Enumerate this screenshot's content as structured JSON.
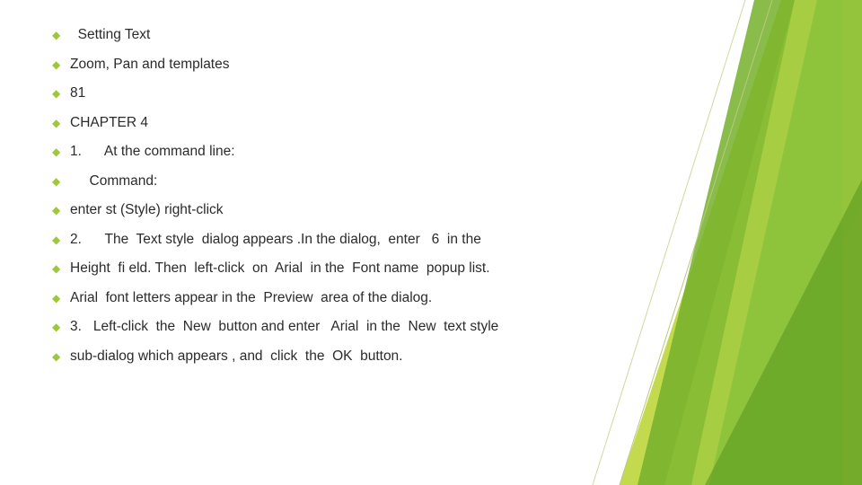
{
  "slide": {
    "bullet_glyph": "◆",
    "bullet_color": "#9ec73c",
    "background_color": "#ffffff",
    "text_color": "#2b2b2b",
    "accent_colors": {
      "light_green": "#c3d94e",
      "mid_green": "#8cc63e",
      "dark_green": "#6aa92a",
      "pale_green": "#dfe9a8",
      "deep_green": "#5f9c22"
    },
    "bullets": [
      {
        "text": "  Setting Text"
      },
      {
        "text": "Zoom, Pan and templates"
      },
      {
        "text": "81"
      },
      {
        "text": "CHAPTER 4"
      },
      {
        "text": "1.      At the command line:"
      },
      {
        "text": "     Command:"
      },
      {
        "text": "enter st (Style) right-click"
      },
      {
        "text": "2.      The  Text style  dialog appears .In the dialog,  enter   6  in the"
      },
      {
        "text": "Height  fi eld. Then  left-click  on  Arial  in the  Font name  popup list."
      },
      {
        "text": "Arial  font letters appear in the  Preview  area of the dialog."
      },
      {
        "text": "3.   Left-click  the  New  button and enter   Arial  in the  New  text style"
      },
      {
        "text": "sub-dialog which appears , and  click  the  OK  button."
      }
    ]
  }
}
